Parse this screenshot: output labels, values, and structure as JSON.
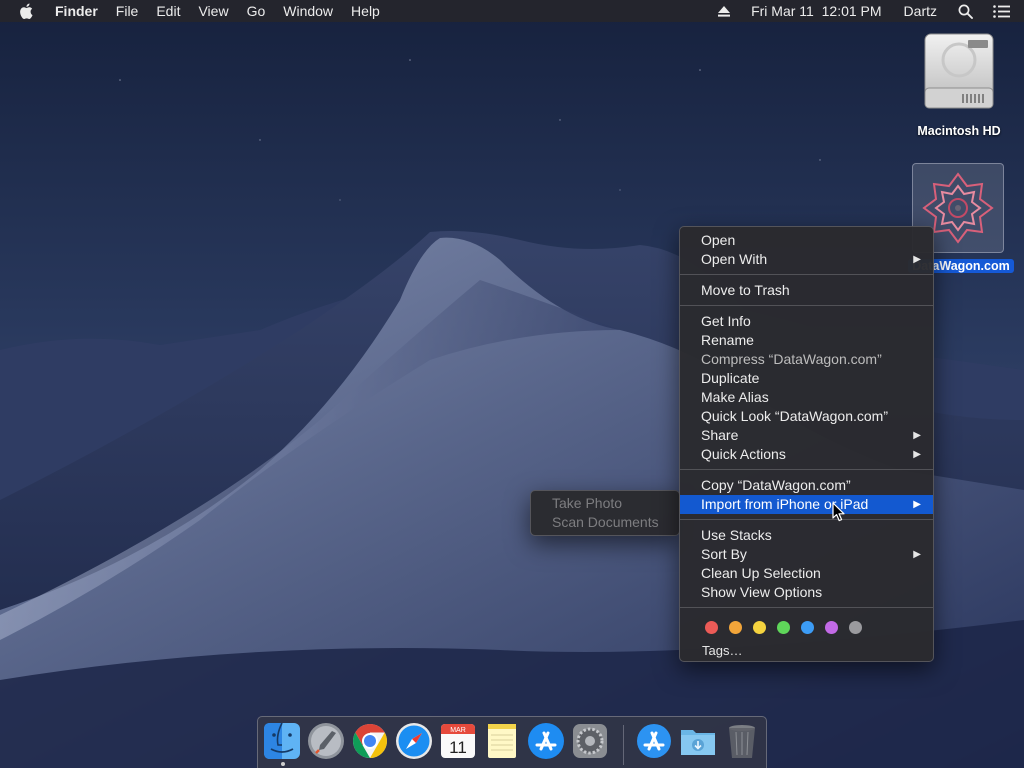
{
  "menubar": {
    "app_name": "Finder",
    "menus": [
      "File",
      "Edit",
      "View",
      "Go",
      "Window",
      "Help"
    ],
    "clock": "Fri Mar 11  12:01 PM",
    "user": "Dartz",
    "icons": [
      "apple-icon",
      "eject-icon",
      "spotlight-search-icon",
      "notification-center-icon"
    ]
  },
  "desktop_icons": [
    {
      "label": "Macintosh HD",
      "icon": "hard-drive-icon"
    },
    {
      "label": "DataWagon.com",
      "icon": "datawagon-logo-icon",
      "selected": true
    }
  ],
  "context_menu": {
    "groups": [
      [
        {
          "label": "Open"
        },
        {
          "label": "Open With",
          "submenu": true
        }
      ],
      [
        {
          "label": "Move to Trash"
        }
      ],
      [
        {
          "label": "Get Info"
        },
        {
          "label": "Rename"
        },
        {
          "label": "Compress “DataWagon.com”",
          "dim": true
        },
        {
          "label": "Duplicate"
        },
        {
          "label": "Make Alias"
        },
        {
          "label": "Quick Look “DataWagon.com”"
        },
        {
          "label": "Share",
          "submenu": true
        },
        {
          "label": "Quick Actions",
          "submenu": true
        }
      ],
      [
        {
          "label": "Copy “DataWagon.com”"
        },
        {
          "label": "Import from iPhone or iPad",
          "submenu": true,
          "highlighted": true
        }
      ],
      [
        {
          "label": "Use Stacks"
        },
        {
          "label": "Sort By",
          "submenu": true
        },
        {
          "label": "Clean Up Selection"
        },
        {
          "label": "Show View Options"
        }
      ]
    ],
    "tag_colors": [
      {
        "name": "red",
        "hex": "#ec5b57"
      },
      {
        "name": "orange",
        "hex": "#f2a53a"
      },
      {
        "name": "yellow",
        "hex": "#f5d33f"
      },
      {
        "name": "green",
        "hex": "#5fd65a"
      },
      {
        "name": "blue",
        "hex": "#3c9cf5"
      },
      {
        "name": "purple",
        "hex": "#c26ae6"
      },
      {
        "name": "gray",
        "hex": "#9a9a9e"
      }
    ],
    "tags_label": "Tags…"
  },
  "import_submenu": {
    "items": [
      {
        "label": "Take Photo",
        "disabled": true
      },
      {
        "label": "Scan Documents",
        "disabled": true
      }
    ]
  },
  "dock": {
    "apps": [
      {
        "name": "Finder",
        "icon": "finder-icon",
        "running": true
      },
      {
        "name": "Launchpad",
        "icon": "launchpad-icon"
      },
      {
        "name": "Google Chrome",
        "icon": "chrome-icon"
      },
      {
        "name": "Safari",
        "icon": "safari-icon"
      },
      {
        "name": "Calendar",
        "icon": "calendar-icon",
        "month": "MAR",
        "day": "11"
      },
      {
        "name": "Notes",
        "icon": "notes-icon"
      },
      {
        "name": "App Store",
        "icon": "app-store-icon"
      },
      {
        "name": "System Preferences",
        "icon": "system-preferences-icon"
      },
      {
        "name": "App Store",
        "icon": "app-store-dock-icon"
      },
      {
        "name": "Downloads",
        "icon": "downloads-folder-icon"
      },
      {
        "name": "Trash",
        "icon": "trash-icon"
      }
    ]
  },
  "colors": {
    "highlight": "#1359d0",
    "menubar_bg": "#26262c",
    "menu_bg": "#2a2a2e"
  }
}
